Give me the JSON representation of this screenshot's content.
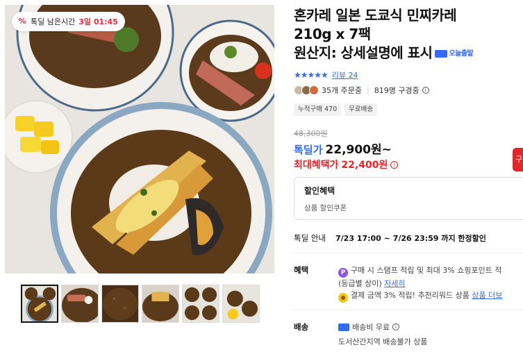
{
  "gallery": {
    "timer_badge": {
      "icon": "percent-icon",
      "label": "톡딜 남은시간",
      "time": "3일 01:45"
    },
    "thumbnail_count": 6,
    "active_thumbnail": 1
  },
  "product": {
    "title_line1": "혼카레 일본 도쿄식 민찌카레",
    "title_line2": "210g x 7팩",
    "title_line3": "원산지: 상세설명에 표시",
    "today_ship_badge": "오늘출발",
    "rating_stars": 5,
    "review_text": "리뷰 24",
    "order_count": "35개 주문중",
    "viewer_count": "819명 구경중",
    "chips": [
      "누적구매 470",
      "무료배송"
    ]
  },
  "price": {
    "original": "48,300원",
    "deal_label": "톡딜가",
    "deal_price": "22,900원~",
    "max_label": "최대혜택가",
    "max_price": "22,400원",
    "cart_tab": "구"
  },
  "coupon": {
    "title": "할인혜택",
    "subtitle": "상품 할인쿠폰"
  },
  "notice": {
    "label": "톡딜 안내",
    "text": "7/23 17:00 ~ 7/26 23:59 까지 한정할인"
  },
  "benefits": {
    "label": "혜택",
    "line1": "구매 시 스탬프 적립 및 최대 3% 쇼핑포인트 적",
    "line1b": "(등급별 상이)",
    "line1_link": "자세히",
    "line2": "결제 금액 3% 적립! 추천리워드 상품",
    "line2_link": "상품 더보"
  },
  "shipping": {
    "label": "배송",
    "fee": "배송비 무료",
    "note": "도서산간지역 배송불가 상품"
  },
  "colors": {
    "accent_blue": "#346aff",
    "price_red": "#e52528",
    "point_purple": "#8a56e2"
  }
}
